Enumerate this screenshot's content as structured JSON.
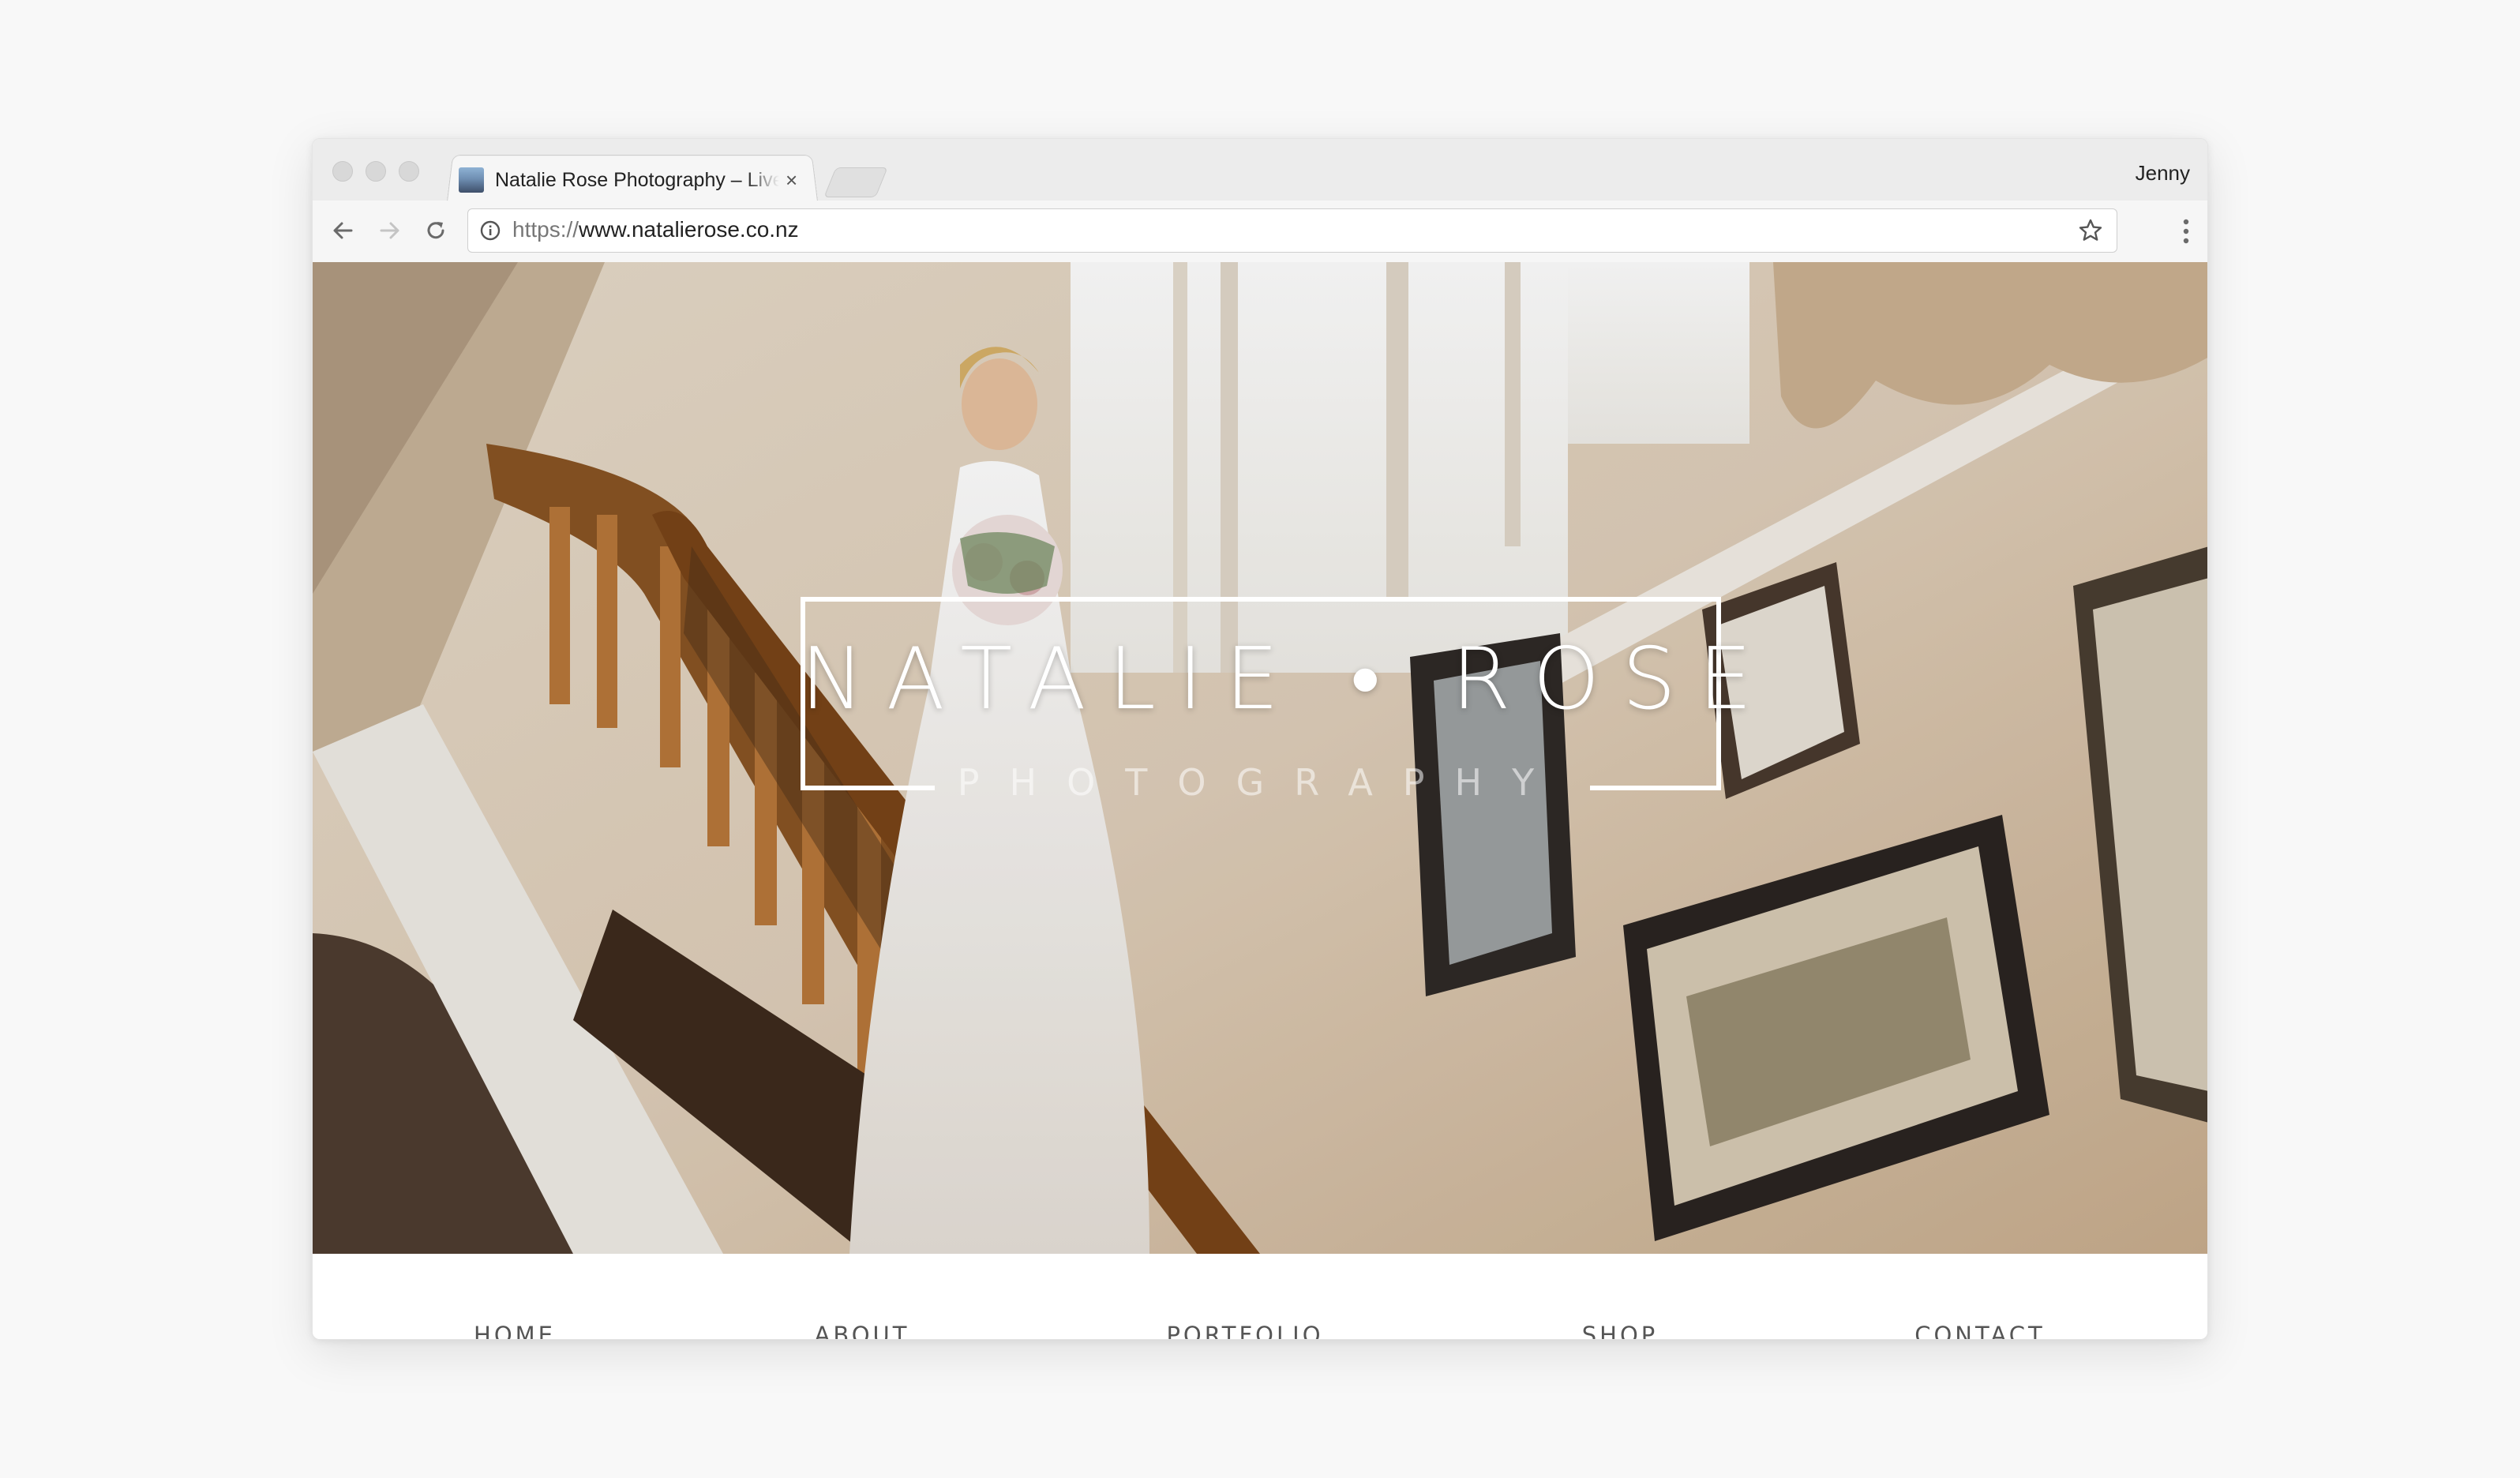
{
  "browser": {
    "tab_title": "Natalie Rose Photography – Live",
    "tab_close": "×",
    "profile_name": "Jenny",
    "url_scheme": "https://",
    "url_host": "www.natalierose.co.nz"
  },
  "hero": {
    "logo_title": "NATALIE • ROSE",
    "logo_subtitle": "PHOTOGRAPHY",
    "image_description_colors": {
      "wall": "#e6d8c6",
      "stair_wood": "#b47a3c",
      "window_light": "#fbfbf8"
    }
  },
  "nav": {
    "items": [
      "HOME",
      "ABOUT",
      "PORTFOLIO",
      "SHOP",
      "CONTACT"
    ]
  },
  "colors": {
    "background": "#f8f8f8",
    "nav_text": "#555555",
    "logo": "#ffffff"
  }
}
